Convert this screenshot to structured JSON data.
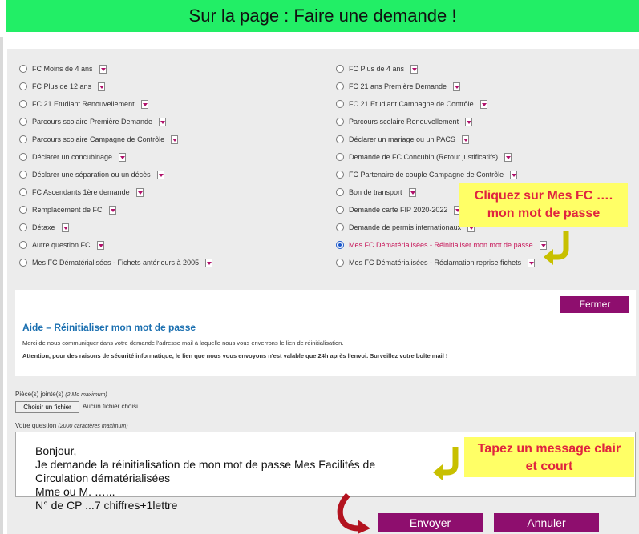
{
  "banner": {
    "title": "Sur la page : Faire une demande !"
  },
  "options_left": [
    "FC Moins de 4 ans",
    "FC Plus de 12 ans",
    "FC 21 Etudiant Renouvellement",
    "Parcours scolaire Première Demande",
    "Parcours scolaire Campagne de Contrôle",
    "Déclarer un concubinage",
    "Déclarer une séparation ou un décès",
    "FC Ascendants 1ère demande",
    "Remplacement de FC",
    "Détaxe",
    "Autre question FC",
    "Mes FC Dématérialisées - Fichets antérieurs à 2005"
  ],
  "options_right": [
    "FC Plus de 4 ans",
    "FC 21 ans Première Demande",
    "FC 21 Etudiant Campagne de Contrôle",
    "Parcours scolaire Renouvellement",
    "Déclarer un mariage ou un PACS",
    "Demande de FC Concubin (Retour justificatifs)",
    "FC Partenaire de couple Campagne de Contrôle",
    "Bon de transport",
    "Demande carte FIP 2020-2022",
    "Demande de permis internationaux",
    "Mes FC Dématérialisées - Réinitialiser mon mot de passe",
    "Mes FC Dématérialisées - Réclamation reprise fichets"
  ],
  "selected_option": "Mes FC Dématérialisées - Réinitialiser mon mot de passe",
  "callout_top": {
    "line1": "Cliquez sur Mes FC ….",
    "line2": "mon mot de passe"
  },
  "callout_bottom": {
    "line1": "Tapez un message clair",
    "line2": "et court"
  },
  "help": {
    "close_label": "Fermer",
    "title": "Aide – Réinitialiser mon mot de passe",
    "text1": "Merci de nous communiquer dans votre demande l'adresse mail à laquelle nous vous enverrons le lien de réinitialisation.",
    "text2": "Attention, pour des raisons de sécurité informatique, le lien que nous vous envoyons n'est valable que 24h après l'envoi. Surveillez votre boîte mail !"
  },
  "attachments": {
    "label": "Pièce(s) jointe(s)",
    "hint": "(2 Mo maximum)",
    "button": "Choisir un fichier",
    "status": "Aucun fichier choisi"
  },
  "question": {
    "label": "Votre question",
    "hint": "(2000 caractères maximum)",
    "lines": [
      "Bonjour,",
      "Je demande la réinitialisation de mon mot de passe Mes Facilités de",
      "Circulation dématérialisées",
      "Mme ou M. …...",
      "N° de CP ...7 chiffres+1lettre"
    ]
  },
  "buttons": {
    "send": "Envoyer",
    "cancel": "Annuler"
  },
  "colors": {
    "banner": "#22ee66",
    "button": "#8e0e6e",
    "callout_bg": "#ffff66",
    "callout_text": "#e0243f",
    "hook": "#c8c000"
  }
}
